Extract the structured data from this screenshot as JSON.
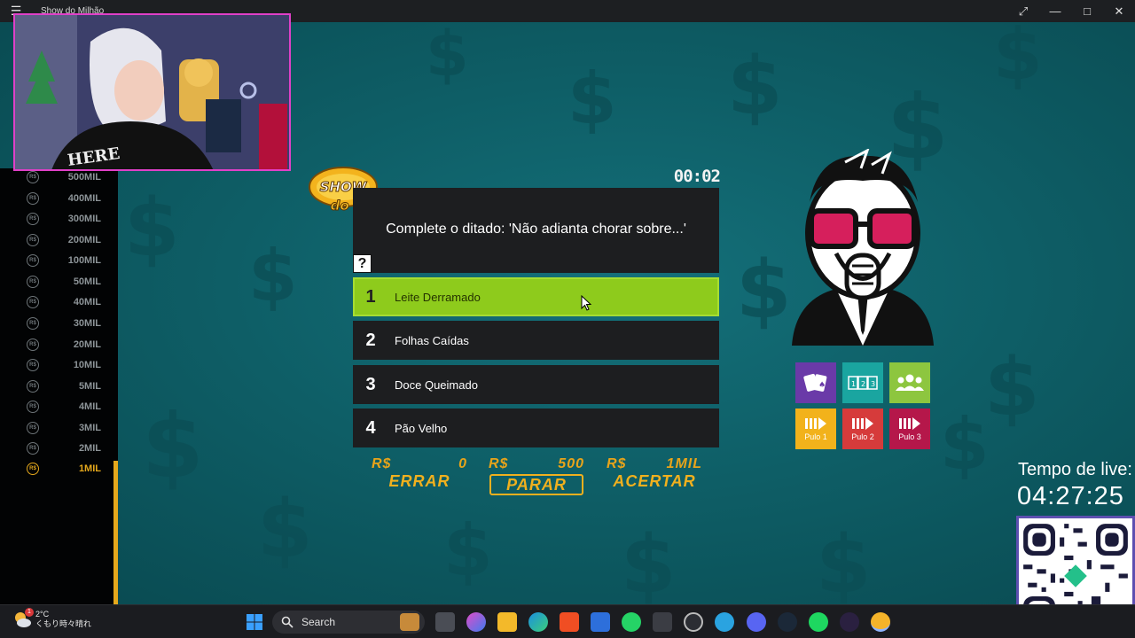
{
  "window": {
    "title": "Show do Milhão",
    "menu_icon": "hamburger-icon",
    "controls": [
      "expand-icon",
      "minimize-icon",
      "maximize-icon",
      "close-icon"
    ]
  },
  "ladder": {
    "currency": "R$",
    "levels": [
      "500MIL",
      "400MIL",
      "300MIL",
      "200MIL",
      "100MIL",
      "50MIL",
      "40MIL",
      "30MIL",
      "20MIL",
      "10MIL",
      "5MIL",
      "4MIL",
      "3MIL",
      "2MIL",
      "1MIL"
    ],
    "current": "1MIL"
  },
  "game": {
    "logo_top": "SHOW",
    "logo_bottom": "do MILHÃO",
    "timer": "00:02",
    "question": "Complete o ditado: 'Não adianta chorar sobre...'",
    "help_label": "?",
    "answers": [
      {
        "num": "1",
        "label": "Leite Derramado",
        "selected": true
      },
      {
        "num": "2",
        "label": "Folhas Caídas",
        "selected": false
      },
      {
        "num": "3",
        "label": "Doce Queimado",
        "selected": false
      },
      {
        "num": "4",
        "label": "Pão Velho",
        "selected": false
      }
    ],
    "score": {
      "currency": "R$",
      "errar_value": "0",
      "errar_label": "ERRAR",
      "parar_value": "500",
      "parar_label": "PARAR",
      "acertar_value": "1MIL",
      "acertar_label": "ACERTAR"
    },
    "lifelines": [
      {
        "name": "cards",
        "icon": "cards-icon",
        "color": "#6a3aa8",
        "label": ""
      },
      {
        "name": "placas",
        "icon": "placards-icon",
        "color": "#1aa5a0",
        "label": ""
      },
      {
        "name": "universitarios",
        "icon": "group-icon",
        "color": "#8dc63f",
        "label": ""
      },
      {
        "name": "pulo1",
        "icon": "skip-icon",
        "color": "#f2b21b",
        "label": "Pulo 1"
      },
      {
        "name": "pulo2",
        "icon": "skip-icon",
        "color": "#d63b3b",
        "label": "Pulo 2"
      },
      {
        "name": "pulo3",
        "icon": "skip-icon",
        "color": "#b5174a",
        "label": "Pulo 3"
      }
    ]
  },
  "stream": {
    "live_label": "Tempo de live:",
    "live_time": "04:27:25"
  },
  "taskbar": {
    "temperature": "2°C",
    "weather": "くもり時々晴れ",
    "weather_badge": "1",
    "search_placeholder": "Search"
  }
}
